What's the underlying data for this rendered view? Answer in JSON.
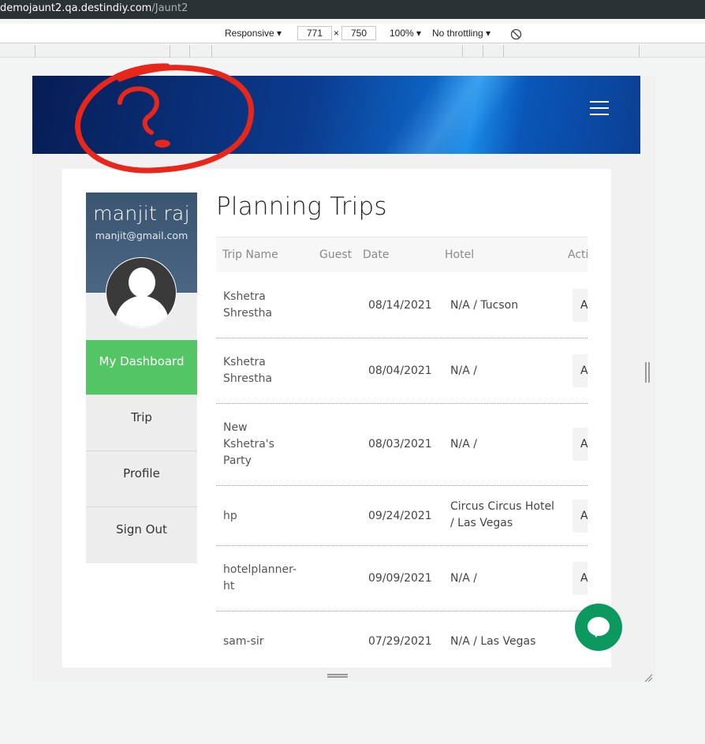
{
  "browser": {
    "url_host": "demojaunt2.qa.destindiy.com",
    "url_path": "/Jaunt2"
  },
  "devtools": {
    "device": "Responsive ▾",
    "width": "771",
    "times": "×",
    "height": "750",
    "zoom": "100% ▾",
    "throttling": "No throttling ▾"
  },
  "profile": {
    "name": "manjit raj",
    "email": "manjit@gmail.com"
  },
  "nav": [
    {
      "label": "My Dashboard",
      "active": true
    },
    {
      "label": "Trip",
      "active": false
    },
    {
      "label": "Profile",
      "active": false
    },
    {
      "label": "Sign Out",
      "active": false
    }
  ],
  "page": {
    "title": "Planning Trips"
  },
  "table": {
    "headers": [
      "Trip Name",
      "Guest",
      "Date",
      "Hotel",
      "Acti"
    ],
    "rows": [
      {
        "trip_name": "Kshetra Shrestha",
        "guest": "",
        "date": "08/14/2021",
        "hotel": "N/A / Tucson",
        "action": "A"
      },
      {
        "trip_name": "Kshetra Shrestha",
        "guest": "",
        "date": "08/04/2021",
        "hotel": "N/A /",
        "action": "A"
      },
      {
        "trip_name": "New Kshetra's Party",
        "guest": "",
        "date": "08/03/2021",
        "hotel": "N/A /",
        "action": "A"
      },
      {
        "trip_name": "hp",
        "guest": "",
        "date": "09/24/2021",
        "hotel": "Circus Circus Hotel / Las Vegas",
        "action": "A"
      },
      {
        "trip_name": "hotelplanner-ht",
        "guest": "",
        "date": "09/09/2021",
        "hotel": "N/A /",
        "action": "A"
      },
      {
        "trip_name": "sam-sir",
        "guest": "",
        "date": "07/29/2021",
        "hotel": "N/A / Las Vegas",
        "action": ""
      }
    ]
  },
  "colors": {
    "active_nav": "#54c564",
    "chat_button": "#0c9960",
    "profile_header": "#3b5571",
    "annotation": "#e8261a"
  }
}
